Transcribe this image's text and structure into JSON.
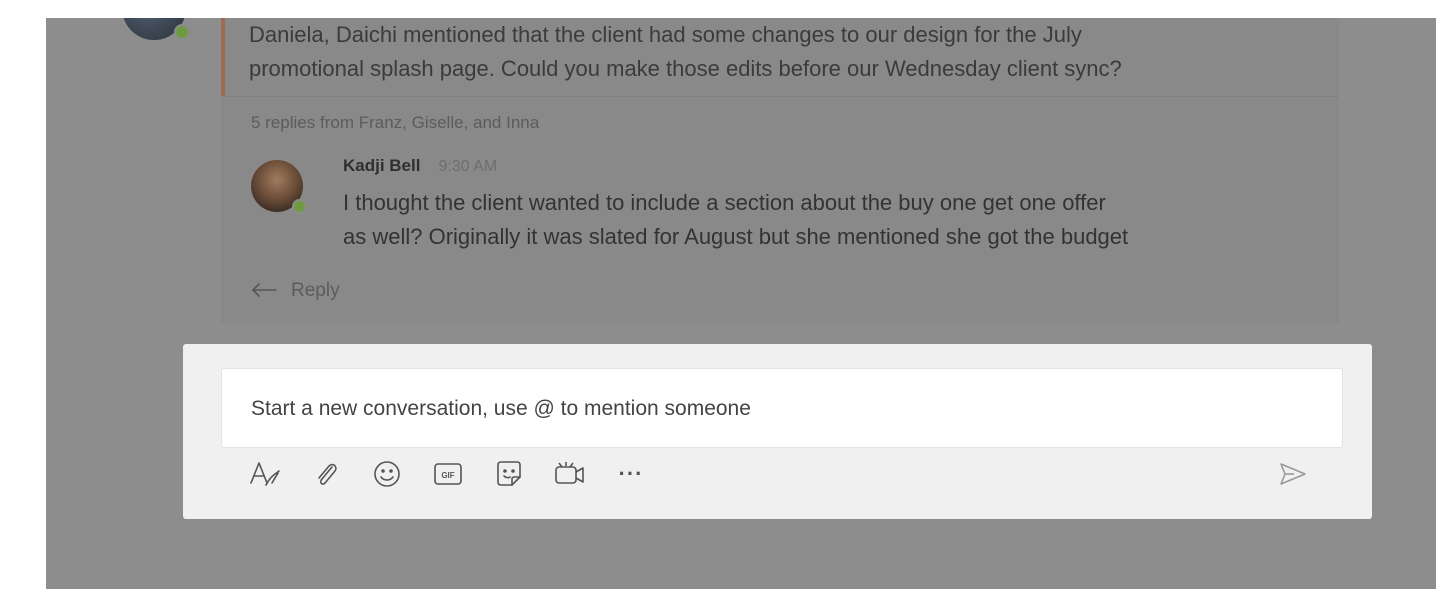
{
  "root_message": {
    "text_line1": "Daniela, Daichi mentioned that the client had some changes to our design for the July",
    "text_line2": "promotional splash page. Could you make those edits before our Wednesday client sync?"
  },
  "thread": {
    "replies_summary": "5 replies from Franz, Giselle, and Inna",
    "latest_reply": {
      "author": "Kadji Bell",
      "time": "9:30 AM",
      "text": "I thought the client wanted to include a section about the buy one get one offer\nas well? Originally it was slated for August but she mentioned she got the budget"
    },
    "reply_label": "Reply"
  },
  "compose": {
    "placeholder": "Start a new conversation, use @ to mention someone",
    "toolbar": [
      {
        "icon": "format-icon"
      },
      {
        "icon": "attach-icon"
      },
      {
        "icon": "emoji-icon"
      },
      {
        "icon": "gif-icon",
        "label": "GIF"
      },
      {
        "icon": "sticker-icon"
      },
      {
        "icon": "meet-now-icon"
      },
      {
        "icon": "more-options-icon",
        "label": "···"
      }
    ],
    "send_icon": "send-icon"
  },
  "colors": {
    "overlay": "#8d8d8d",
    "accent_bar": "#9d6a55",
    "presence": "#6f9a3f",
    "compose_bg": "#f0f0f0"
  }
}
